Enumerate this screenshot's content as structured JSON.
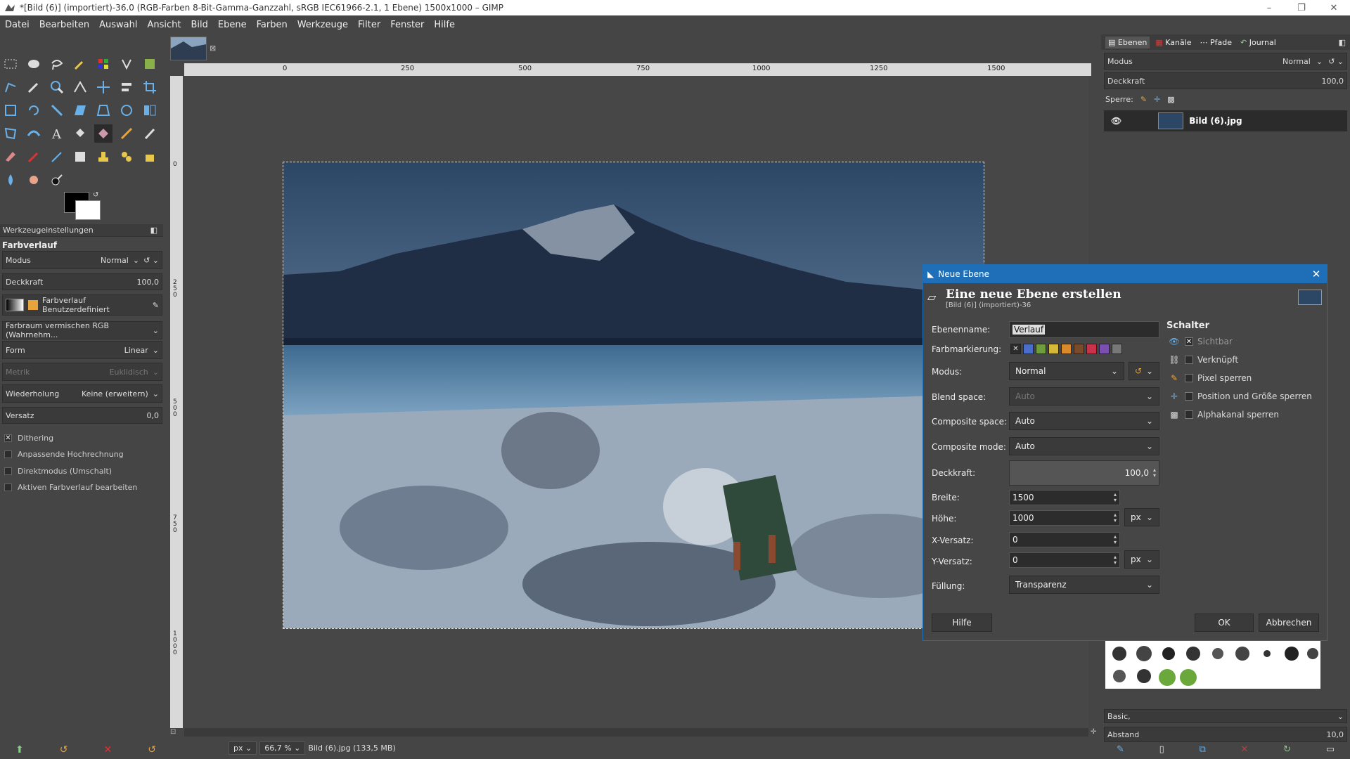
{
  "window": {
    "title": "*[Bild (6)] (importiert)-36.0 (RGB-Farben 8-Bit-Gamma-Ganzzahl, sRGB IEC61966-2.1, 1 Ebene) 1500x1000 – GIMP",
    "minimize": "–",
    "maximize": "❐",
    "close": "✕"
  },
  "menu": [
    "Datei",
    "Bearbeiten",
    "Auswahl",
    "Ansicht",
    "Bild",
    "Ebene",
    "Farben",
    "Werkzeuge",
    "Filter",
    "Fenster",
    "Hilfe"
  ],
  "tool_options": {
    "header": "Werkzeugeinstellungen",
    "tool_name": "Farbverlauf",
    "mode_label": "Modus",
    "mode_value": "Normal",
    "opacity_label": "Deckkraft",
    "opacity_value": "100,0",
    "gradient_name": "Farbverlauf",
    "gradient_value": "Benutzerdefiniert",
    "blend_space": "Farbraum vermischen RGB (Wahrnehm...",
    "form_label": "Form",
    "form_value": "Linear",
    "metric_label": "Metrik",
    "metric_value": "Euklidisch",
    "repeat_label": "Wiederholung",
    "repeat_value": "Keine (erweitern)",
    "offset_label": "Versatz",
    "offset_value": "0,0",
    "dithering": "Dithering",
    "adaptive": "Anpassende Hochrechnung",
    "direct": "Direktmodus (Umschalt)",
    "edit_active": "Aktiven Farbverlauf bearbeiten"
  },
  "ruler": {
    "h_ticks": [
      "0",
      "250",
      "500",
      "750",
      "1000",
      "1250",
      "1500"
    ],
    "v_ticks": [
      "0",
      "2 5 0",
      "5 0 0",
      "7 5 0",
      "1 0 0 0"
    ]
  },
  "status": {
    "unit": "px",
    "zoom": "66,7 %",
    "file_info": "Bild (6).jpg (133,5 MB)"
  },
  "layers_panel": {
    "tabs": [
      "Ebenen",
      "Kanäle",
      "Pfade",
      "Journal"
    ],
    "mode_label": "Modus",
    "mode_value": "Normal",
    "opacity_label": "Deckkraft",
    "opacity_value": "100,0",
    "lock_label": "Sperre:",
    "layer_name": "Bild (6).jpg"
  },
  "brushes_panel": {
    "preset": "Basic,",
    "spacing_label": "Abstand",
    "spacing_value": "10,0"
  },
  "dialog": {
    "title": "Neue Ebene",
    "heading": "Eine neue Ebene erstellen",
    "subheading": "[Bild (6)] (importiert)-36",
    "layer_name_label": "Ebenenname:",
    "layer_name_value": "Verlauf",
    "color_tag_label": "Farbmarkierung:",
    "color_tags": [
      "#4b6ec8",
      "#6f9c3c",
      "#d4b83a",
      "#d98b2b",
      "#7a4b2a",
      "#c8324a",
      "#7b4fb0",
      "#777777"
    ],
    "mode_label": "Modus:",
    "mode_value": "Normal",
    "blend_space_label": "Blend space:",
    "blend_space_value": "Auto",
    "composite_space_label": "Composite space:",
    "composite_space_value": "Auto",
    "composite_mode_label": "Composite mode:",
    "composite_mode_value": "Auto",
    "opacity_label": "Deckkraft:",
    "opacity_value": "100,0",
    "width_label": "Breite:",
    "width_value": "1500",
    "height_label": "Höhe:",
    "height_value": "1000",
    "unit": "px",
    "xoffset_label": "X-Versatz:",
    "xoffset_value": "0",
    "yoffset_label": "Y-Versatz:",
    "yoffset_value": "0",
    "fill_label": "Füllung:",
    "fill_value": "Transparenz",
    "switches_header": "Schalter",
    "switches": [
      "Sichtbar",
      "Verknüpft",
      "Pixel sperren",
      "Position und Größe sperren",
      "Alphakanal sperren"
    ],
    "help_button": "Hilfe",
    "ok_button": "OK",
    "cancel_button": "Abbrechen"
  }
}
